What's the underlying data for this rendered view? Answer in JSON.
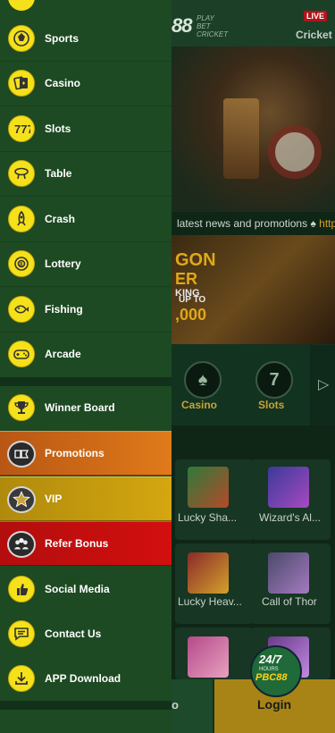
{
  "background": {
    "logo": "88",
    "logo_sub": "PLAY\nBET\nCRICKET",
    "live_badge": "LIVE",
    "header_right_label": "Cricket",
    "news_text": "latest news and promotions",
    "news_link": "http",
    "promo_line1": "GON",
    "promo_line2": "ER",
    "promo_line3": "KING",
    "promo_line4": "UP TO",
    "promo_line5": ",000",
    "categories": [
      {
        "label": "Casino",
        "icon": "casino-icon"
      },
      {
        "label": "Slots",
        "icon": "slots-icon"
      }
    ],
    "games": [
      {
        "label": "Lucky Sha..."
      },
      {
        "label": "Wizard's Al..."
      },
      {
        "label": "Lucky Heav..."
      },
      {
        "label": "Call of Thor"
      },
      {
        "label": ""
      },
      {
        "label": ""
      }
    ],
    "bottom_left_label": "o",
    "login_label": "Login",
    "support_title": "24/7",
    "support_sub": "HOURS",
    "support_brand": "PBC88"
  },
  "drawer": {
    "items": [
      {
        "label": "Sports",
        "icon": "sports-icon"
      },
      {
        "label": "Casino",
        "icon": "casino-icon"
      },
      {
        "label": "Slots",
        "icon": "slots-icon"
      },
      {
        "label": "Table",
        "icon": "table-icon"
      },
      {
        "label": "Crash",
        "icon": "crash-rocket-icon"
      },
      {
        "label": "Lottery",
        "icon": "lottery-icon"
      },
      {
        "label": "Fishing",
        "icon": "fishing-icon"
      },
      {
        "label": "Arcade",
        "icon": "arcade-gamepad-icon"
      }
    ],
    "extras": [
      {
        "label": "Winner Board",
        "icon": "trophy-icon"
      },
      {
        "label": "Promotions",
        "icon": "promotions-icon"
      },
      {
        "label": "VIP",
        "icon": "vip-icon"
      },
      {
        "label": "Refer Bonus",
        "icon": "refer-bonus-icon"
      },
      {
        "label": "Social Media",
        "icon": "social-media-icon"
      },
      {
        "label": "Contact Us",
        "icon": "contact-chat-icon"
      },
      {
        "label": "APP Download",
        "icon": "download-icon"
      }
    ],
    "colors": {
      "drawer_bg": "#1d4a22",
      "icon_yellow": "#f5e11a",
      "promo_orange": "#d06a16",
      "vip_gold": "#c29a0e",
      "refer_red": "#c60e0e"
    }
  }
}
